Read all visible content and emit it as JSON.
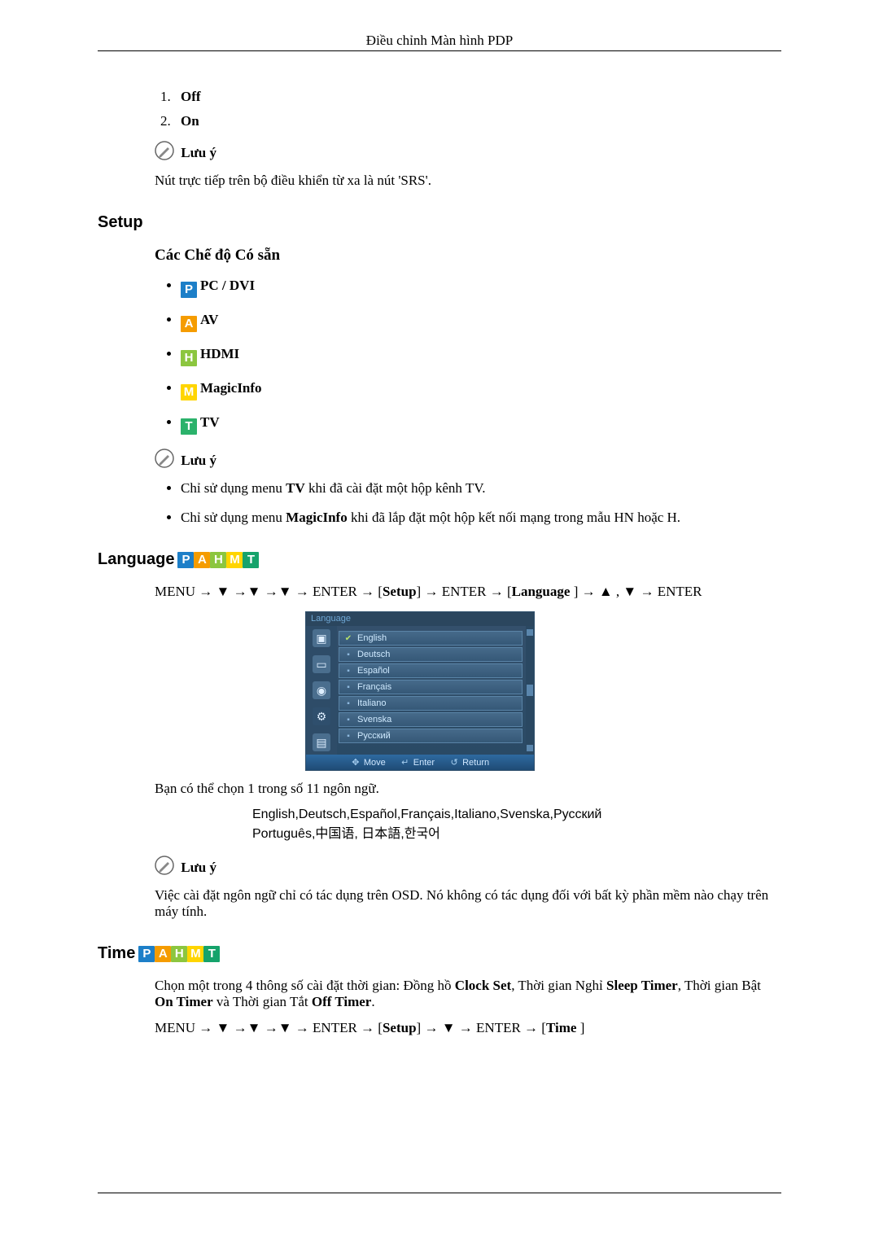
{
  "header": "Điều chỉnh Màn hình PDP",
  "offon_list": {
    "off": "Off",
    "on": "On"
  },
  "note_label": "Lưu ý",
  "note_srs": "Nút trực tiếp trên bộ điều khiển từ xa là nút 'SRS'.",
  "setup_heading": "Setup",
  "modes_heading": "Các Chế độ Có sẵn",
  "modes": {
    "pcdvi": "PC / DVI",
    "av": "AV",
    "hdmi": "HDMI",
    "magicinfo": "MagicInfo",
    "tv": "TV"
  },
  "modes_note_tv_pre": "Chỉ sử dụng menu ",
  "modes_note_tv_bold": "TV",
  "modes_note_tv_post": " khi đã cài đặt một hộp kênh TV.",
  "modes_note_mi_pre": "Chỉ sử dụng menu ",
  "modes_note_mi_bold": "MagicInfo",
  "modes_note_mi_post": " khi đã lắp đặt một hộp kết nối mạng trong mẫu HN hoặc H.",
  "language_heading": "Language",
  "language_path_pre": "MENU → ▼ →▼ →▼ → ENTER → [",
  "language_path_mid1": "Setup",
  "language_path_mid2": "] → ENTER → [",
  "language_path_mid3": "Language",
  "language_path_post": " ] → ▲ , ▼ → ENTER",
  "osd": {
    "title": "Language",
    "items": [
      "English",
      "Deutsch",
      "Español",
      "Français",
      "Italiano",
      "Svenska",
      "Русский"
    ],
    "footer_move": "Move",
    "footer_enter": "Enter",
    "footer_return": "Return"
  },
  "lang_choose": "Bạn có thể chọn 1 trong số 11 ngôn ngữ.",
  "lang_list_line1": "English,Deutsch,Español,Français,Italiano,Svenska,Русский",
  "lang_list_line2": "Português,中国语, 日本語,한국어",
  "lang_note": "Việc cài đặt ngôn ngữ chỉ có tác dụng trên OSD. Nó không có tác dụng đối với bất kỳ phần mềm nào chạy trên máy tính.",
  "time_heading": "Time",
  "time_para_pre": "Chọn một trong 4 thông số cài đặt thời gian: Đồng hồ ",
  "time_para_b1": "Clock Set",
  "time_para_m1": ", Thời gian Nghỉ ",
  "time_para_b2": "Sleep Timer",
  "time_para_m2": ", Thời gian Bật ",
  "time_para_b3": "On Timer",
  "time_para_m3": " và Thời gian Tắt ",
  "time_para_b4": "Off Timer",
  "time_para_end": ".",
  "time_path_pre": "MENU → ▼ →▼ →▼ → ENTER → [",
  "time_path_mid1": "Setup",
  "time_path_mid2": "] → ▼ → ENTER → [",
  "time_path_mid3": "Time",
  "time_path_post": " ]"
}
